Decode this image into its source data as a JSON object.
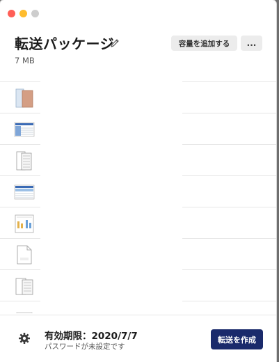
{
  "window": {
    "title": "転送パッケージ",
    "size": "7 MB"
  },
  "header": {
    "add_capacity_label": "容量を追加する",
    "more_label": "..."
  },
  "files": [
    {
      "thumb": "document-pdf-icon"
    },
    {
      "thumb": "spreadsheet-icon"
    },
    {
      "thumb": "table-document-icon"
    },
    {
      "thumb": "spreadsheet-icon"
    },
    {
      "thumb": "chart-document-icon"
    },
    {
      "thumb": "csv-file-icon"
    },
    {
      "thumb": "table-document-icon"
    },
    {
      "thumb": "document-icon"
    }
  ],
  "footer": {
    "expiry": "有効期限：2020/7/7",
    "password_status": "パスワードが未設定です",
    "create_button": "転送を作成"
  },
  "colors": {
    "primary_button": "#1a2a6b",
    "secondary_button": "#ececec",
    "close": "#ff5f57",
    "minimize": "#febc2e"
  }
}
